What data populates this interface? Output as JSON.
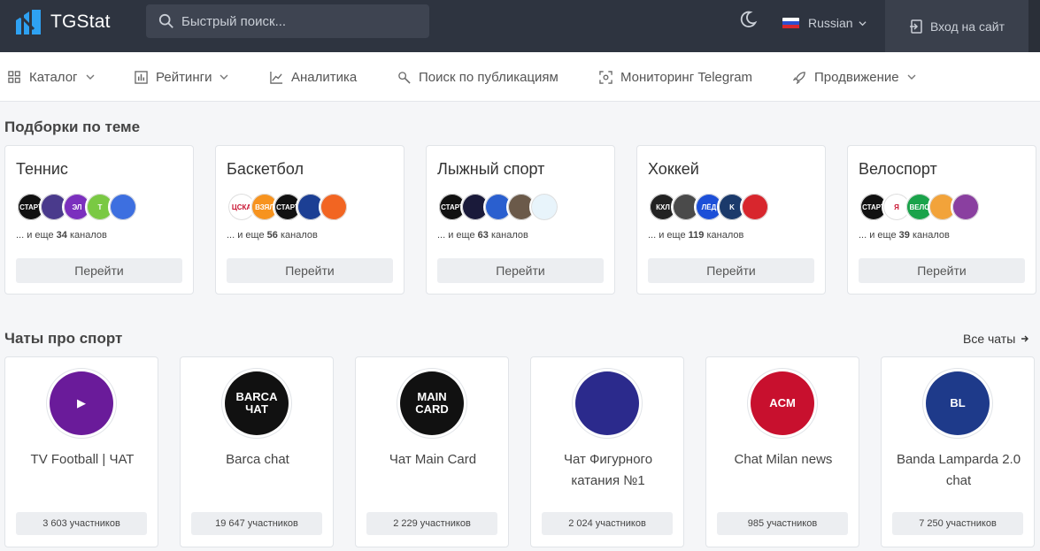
{
  "header": {
    "logo_text": "TGStat",
    "search_placeholder": "Быстрый поиск...",
    "language": "Russian",
    "login_label": "Вход на сайт"
  },
  "nav": [
    {
      "label": "Каталог",
      "icon": "grid-icon",
      "dropdown": true
    },
    {
      "label": "Рейтинги",
      "icon": "bar-chart-icon",
      "dropdown": true
    },
    {
      "label": "Аналитика",
      "icon": "line-chart-icon",
      "dropdown": false
    },
    {
      "label": "Поиск по публикациям",
      "icon": "key-search-icon",
      "dropdown": false
    },
    {
      "label": "Мониторинг Telegram",
      "icon": "monitor-icon",
      "dropdown": false
    },
    {
      "label": "Продвижение",
      "icon": "rocket-icon",
      "dropdown": true
    }
  ],
  "sections": {
    "topics_title": "Подборки по теме",
    "chats_title": "Чаты про спорт",
    "all_chats_label": "Все чаты"
  },
  "topics": [
    {
      "title": "Теннис",
      "more_prefix": "... и еще",
      "count": "34",
      "more_suffix": "каналов",
      "button": "Перейти",
      "avatars": [
        {
          "bg": "#111111",
          "text": "СТАРТ"
        },
        {
          "bg": "#4a3a8c",
          "text": ""
        },
        {
          "bg": "#7b2fbe",
          "text": "ЭЛ"
        },
        {
          "bg": "#7ac943",
          "text": "T"
        },
        {
          "bg": "#3d6fe0",
          "text": ""
        }
      ]
    },
    {
      "title": "Баскетбол",
      "more_prefix": "... и еще",
      "count": "56",
      "more_suffix": "каналов",
      "button": "Перейти",
      "avatars": [
        {
          "bg": "#ffffff",
          "text": "ЦСКА"
        },
        {
          "bg": "#f7931e",
          "text": "ВЗЯЛ"
        },
        {
          "bg": "#111111",
          "text": "СТАРТ"
        },
        {
          "bg": "#1c3f94",
          "text": ""
        },
        {
          "bg": "#f26522",
          "text": ""
        }
      ]
    },
    {
      "title": "Лыжный спорт",
      "more_prefix": "... и еще",
      "count": "63",
      "more_suffix": "каналов",
      "button": "Перейти",
      "avatars": [
        {
          "bg": "#111111",
          "text": "СТАРТ"
        },
        {
          "bg": "#1a1a3a",
          "text": ""
        },
        {
          "bg": "#2a5fcf",
          "text": ""
        },
        {
          "bg": "#6b5a4a",
          "text": ""
        },
        {
          "bg": "#e8f4fb",
          "text": ""
        }
      ]
    },
    {
      "title": "Хоккей",
      "more_prefix": "... и еще",
      "count": "119",
      "more_suffix": "каналов",
      "button": "Перейти",
      "avatars": [
        {
          "bg": "#222222",
          "text": "КХЛ"
        },
        {
          "bg": "#4a4a4a",
          "text": ""
        },
        {
          "bg": "#1c4fd8",
          "text": "ЛЁД"
        },
        {
          "bg": "#1b3a6b",
          "text": "K"
        },
        {
          "bg": "#d8262d",
          "text": ""
        }
      ]
    },
    {
      "title": "Велоспорт",
      "more_prefix": "... и еще",
      "count": "39",
      "more_suffix": "каналов",
      "button": "Перейти",
      "avatars": [
        {
          "bg": "#111111",
          "text": "СТАРТ"
        },
        {
          "bg": "#ffffff",
          "text": "Я"
        },
        {
          "bg": "#1aa34a",
          "text": "ВЕЛО"
        },
        {
          "bg": "#f2a33a",
          "text": ""
        },
        {
          "bg": "#8a3fa0",
          "text": ""
        }
      ]
    }
  ],
  "chats": [
    {
      "name": "TV Football | ЧАТ",
      "members": "3 603 участников",
      "bg": "#6a1b9a",
      "logo_text": "▶"
    },
    {
      "name": "Barca chat",
      "members": "19 647 участников",
      "bg": "#111111",
      "logo_text": "BARCA ЧАТ"
    },
    {
      "name": "Чат Main Card",
      "members": "2 229 участников",
      "bg": "#111111",
      "logo_text": "MAIN CARD"
    },
    {
      "name": "Чат Фигурного катания №1",
      "members": "2 024 участников",
      "bg": "#2b2a8c",
      "logo_text": ""
    },
    {
      "name": "Chat Milan news",
      "members": "985 участников",
      "bg": "#c8102e",
      "logo_text": "ACM"
    },
    {
      "name": "Banda Lamparda 2.0 chat",
      "members": "7 250 участников",
      "bg": "#1e3a8a",
      "logo_text": "BL"
    }
  ]
}
